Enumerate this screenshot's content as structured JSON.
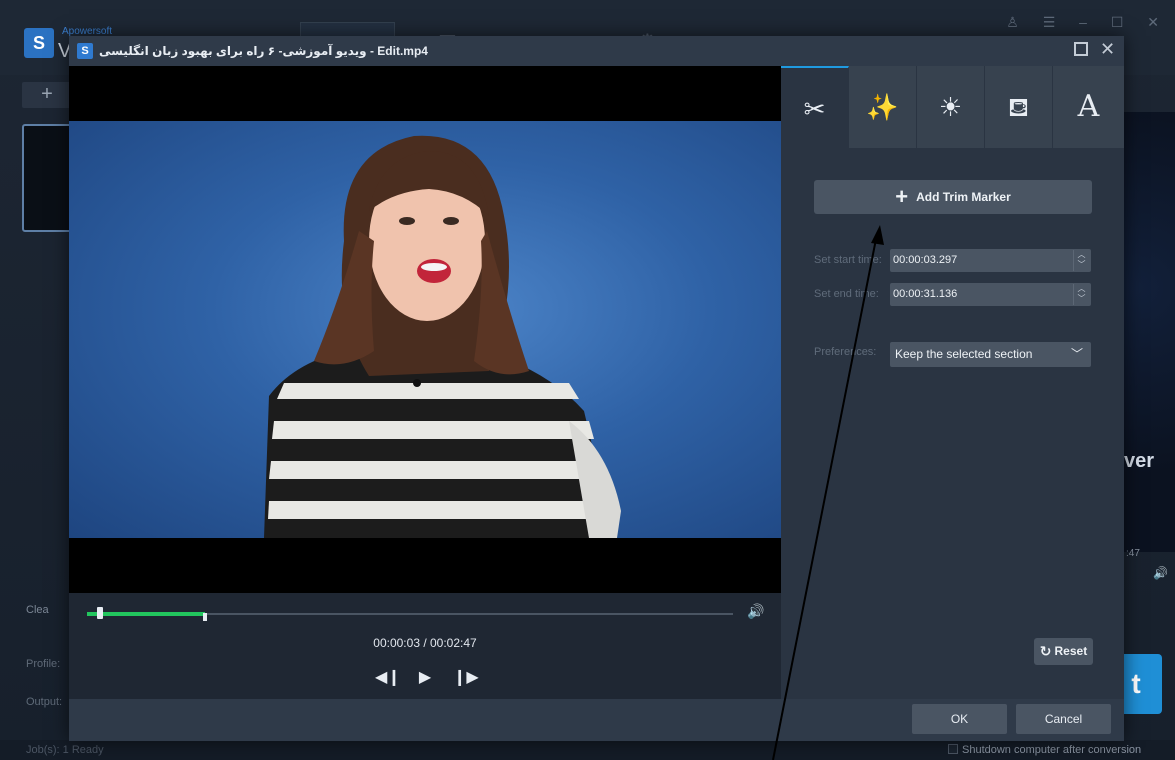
{
  "background_app": {
    "brand_small": "Apowersoft",
    "brand_large": "V",
    "add_label": "+",
    "window_controls": "♙ ☰ – ☐ ✕",
    "side_text_right": "ver",
    "time_fragment": ":47",
    "clear_label": "Clea",
    "profile_label": "Profile:",
    "output_label": "Output:",
    "convert_fragment": "t",
    "jobs_status": "Job(s): 1    Ready",
    "shutdown_label": "Shutdown computer after conversion"
  },
  "dialog": {
    "title": "ویدیو آموزشی- ۶ راه برای بهبود زبان انگلیسی - Edit.mp4",
    "icon_glyph": "S",
    "close_glyph": "✕",
    "tabs": [
      {
        "name": "trim",
        "glyph": "✂"
      },
      {
        "name": "effect",
        "glyph": "✨"
      },
      {
        "name": "adjust",
        "glyph": "☀"
      },
      {
        "name": "watermark",
        "glyph": "⛾"
      },
      {
        "name": "text",
        "glyph": "A"
      }
    ],
    "add_trim_marker_label": "Add Trim Marker",
    "start_time_label": "Set start time:",
    "start_time_value": "00:00:03.297",
    "end_time_label": "Set end time:",
    "end_time_value": "00:00:31.136",
    "preferences_label": "Preferences:",
    "preferences_value": "Keep the selected section",
    "reset_label": "Reset",
    "ok_label": "OK",
    "cancel_label": "Cancel"
  },
  "player": {
    "current_time": "00:00:03",
    "total_time": "00:02:47",
    "time_display": "00:00:03 / 00:02:47",
    "progress_fraction": 0.02
  },
  "colors": {
    "accent": "#1f9ae0",
    "progress": "#22c55e",
    "video_bg": "#2f62a6"
  }
}
